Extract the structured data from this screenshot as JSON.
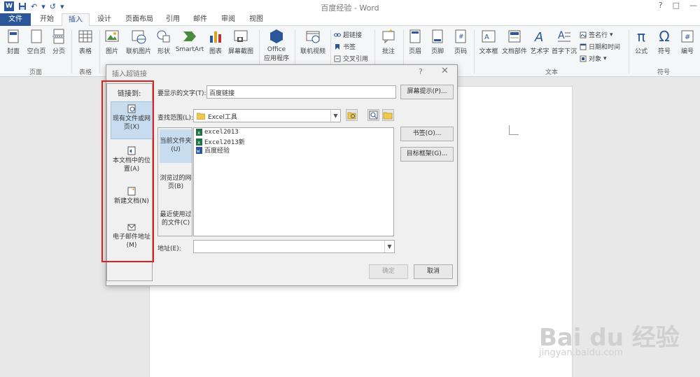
{
  "window": {
    "title": "百度经验 - Word",
    "help": "?",
    "minimize": "—",
    "restore": "□"
  },
  "qat": {
    "app_icon": "W",
    "undo": "↶",
    "redo": "↺",
    "more": "▾"
  },
  "tabs": [
    {
      "label": "文件"
    },
    {
      "label": "开始"
    },
    {
      "label": "插入"
    },
    {
      "label": "设计"
    },
    {
      "label": "页面布局"
    },
    {
      "label": "引用"
    },
    {
      "label": "邮件"
    },
    {
      "label": "审阅"
    },
    {
      "label": "视图"
    }
  ],
  "ribbon": {
    "buttons": {
      "cover": "封面",
      "blank_page": "空白页",
      "page_break": "分页",
      "table": "表格",
      "picture": "图片",
      "online_picture": "联机图片",
      "shapes": "形状",
      "smartart": "SmartArt",
      "chart": "图表",
      "screenshot": "屏幕截图",
      "office_apps_1": "Office",
      "office_apps_2": "应用程序",
      "online_video": "联机视频",
      "hyperlink": "超链接",
      "bookmark": "书签",
      "cross_ref": "交叉引用",
      "comment": "批注",
      "header": "页眉",
      "footer": "页脚",
      "page_number": "页码",
      "textbox": "文本框",
      "quick_parts": "文档部件",
      "wordart": "艺术字",
      "dropcap": "首字下沉",
      "signature": "签名行",
      "datetime": "日期和时间",
      "object": "对象",
      "equation": "公式",
      "symbol": "符号",
      "numbering": "编号"
    },
    "groups": {
      "pages": "页面",
      "tables": "表格",
      "text": "文本",
      "symbols": "符号"
    }
  },
  "dialog": {
    "title": "插入超链接",
    "help": "?",
    "close": "✕",
    "link_to_label": "链接到:",
    "link_to_items": [
      {
        "label": "现有文件或网页(X)"
      },
      {
        "label": "本文档中的位置(A)"
      },
      {
        "label": "新建文档(N)"
      },
      {
        "label": "电子邮件地址(M)"
      }
    ],
    "display_text_label": "要显示的文字(T):",
    "display_text_value": "百度链接",
    "screentip_button": "屏幕提示(P)...",
    "look_in_label": "查找范围(L):",
    "look_in_value": "Excel工具",
    "nav_items": [
      {
        "label": "当前文件夹(U)"
      },
      {
        "label": "浏览过的网页(B)"
      },
      {
        "label": "最近使用过的文件(C)"
      }
    ],
    "files": [
      {
        "name": "excel2013"
      },
      {
        "name": "Excel2013新"
      },
      {
        "name": "百度经验"
      }
    ],
    "bookmark_button": "书签(O)...",
    "target_frame_button": "目标框架(G)...",
    "address_label": "地址(E):",
    "address_value": "",
    "ok_button": "确定",
    "cancel_button": "取消"
  },
  "watermark": {
    "main": "Bai du 经验",
    "sub": "jingyan.baidu.com"
  },
  "colors": {
    "accent": "#2b579a",
    "highlight": "#e02020",
    "selected": "#c8dcf0"
  }
}
